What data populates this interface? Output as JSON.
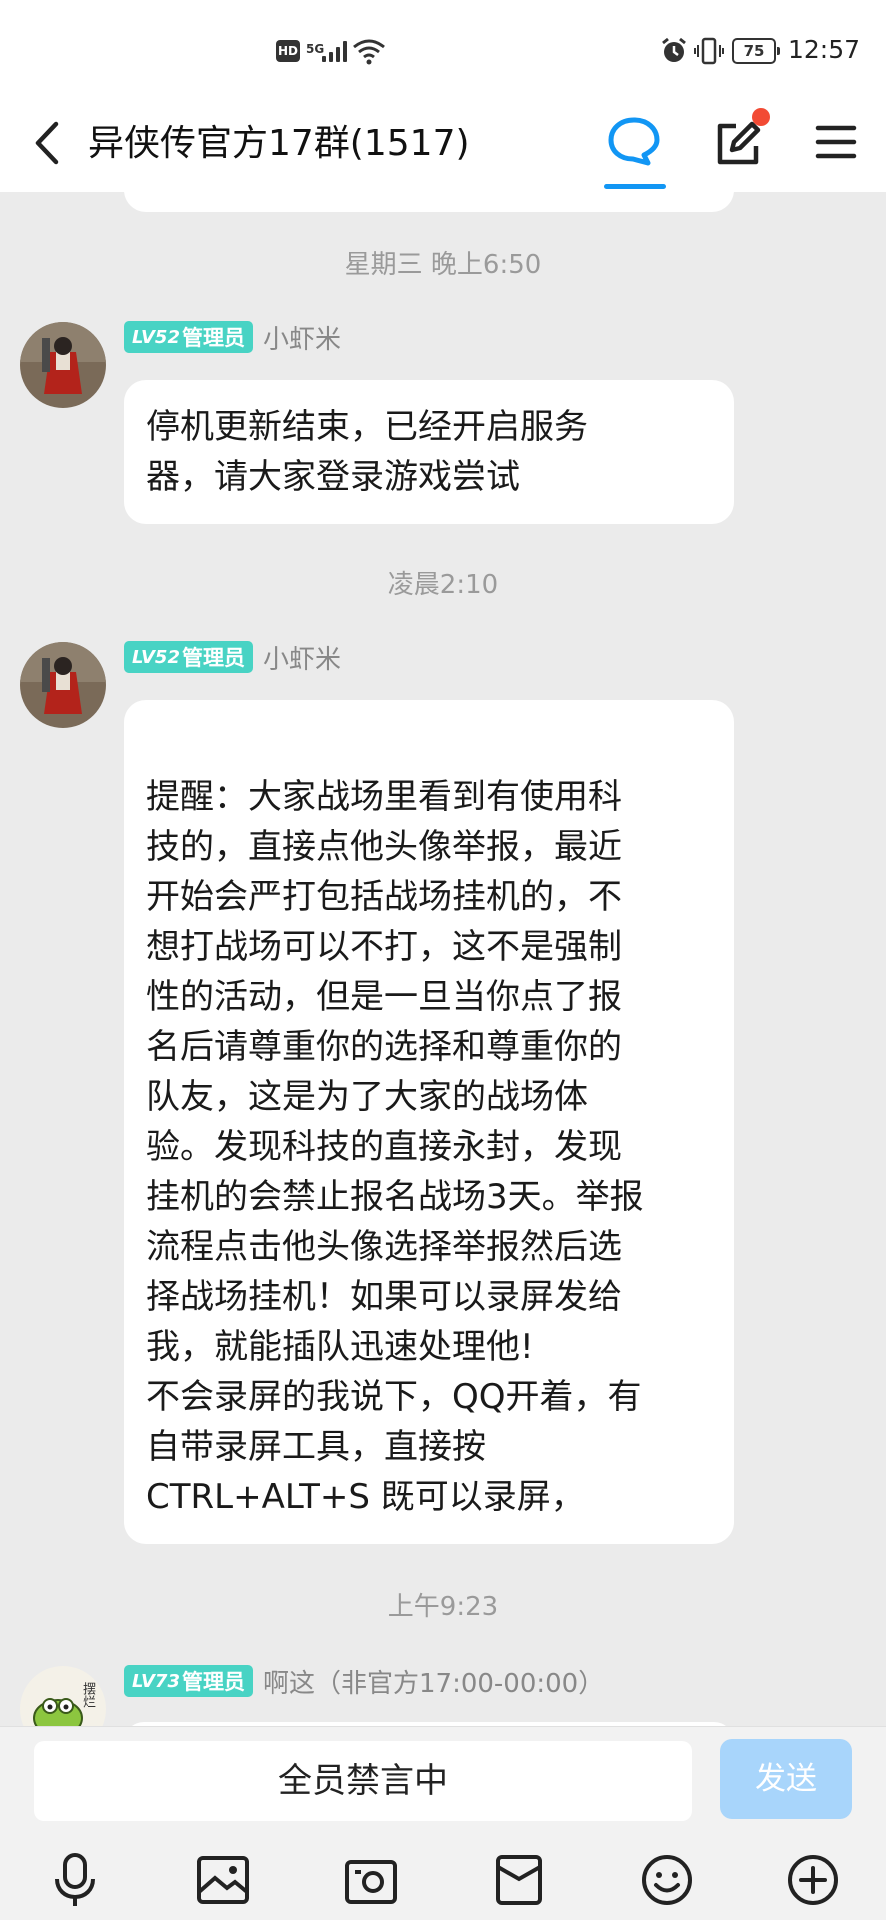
{
  "status_bar": {
    "hd_label": "HD",
    "network_label": "5G",
    "battery": "75",
    "time": "12:57"
  },
  "header": {
    "title": "异侠传官方17群(1517)"
  },
  "messages": [
    {
      "time": "星期三 晚上6:50",
      "level": "LV52",
      "role": "管理员",
      "sender": "小虾米",
      "text": "停机更新结束，已经开启服务\n器，请大家登录游戏尝试"
    },
    {
      "time": "凌晨2:10",
      "level": "LV52",
      "role": "管理员",
      "sender": "小虾米",
      "text": "\n提醒：大家战场里看到有使用科\n技的，直接点他头像举报，最近\n开始会严打包括战场挂机的，不\n想打战场可以不打，这不是强制\n性的活动，但是一旦当你点了报\n名后请尊重你的选择和尊重你的\n队友，这是为了大家的战场体\n验。发现科技的直接永封，发现\n挂机的会禁止报名战场3天。举报\n流程点击他头像选择举报然后选\n择战场挂机！如果可以录屏发给\n我，就能插队迅速处理他!\n不会录屏的我说下，QQ开着，有\n自带录屏工具，直接按\nCTRL+ALT+S 既可以录屏，"
    },
    {
      "time": "上午9:23",
      "level": "LV73",
      "role": "管理员",
      "sender": "啊这（非官方17:00-00:00）",
      "avatar_text": "摆烂"
    }
  ],
  "input": {
    "mute_text": "全员禁言中",
    "send_label": "发送"
  },
  "toolbar": [
    "mic-icon",
    "image-icon",
    "camera-icon",
    "red-packet-icon",
    "emoji-icon",
    "plus-icon"
  ],
  "colors": {
    "accent": "#1296f4",
    "badge": "#48d3c4",
    "send_disabled": "#a8d5fb",
    "notification_dot": "#f24a34"
  }
}
